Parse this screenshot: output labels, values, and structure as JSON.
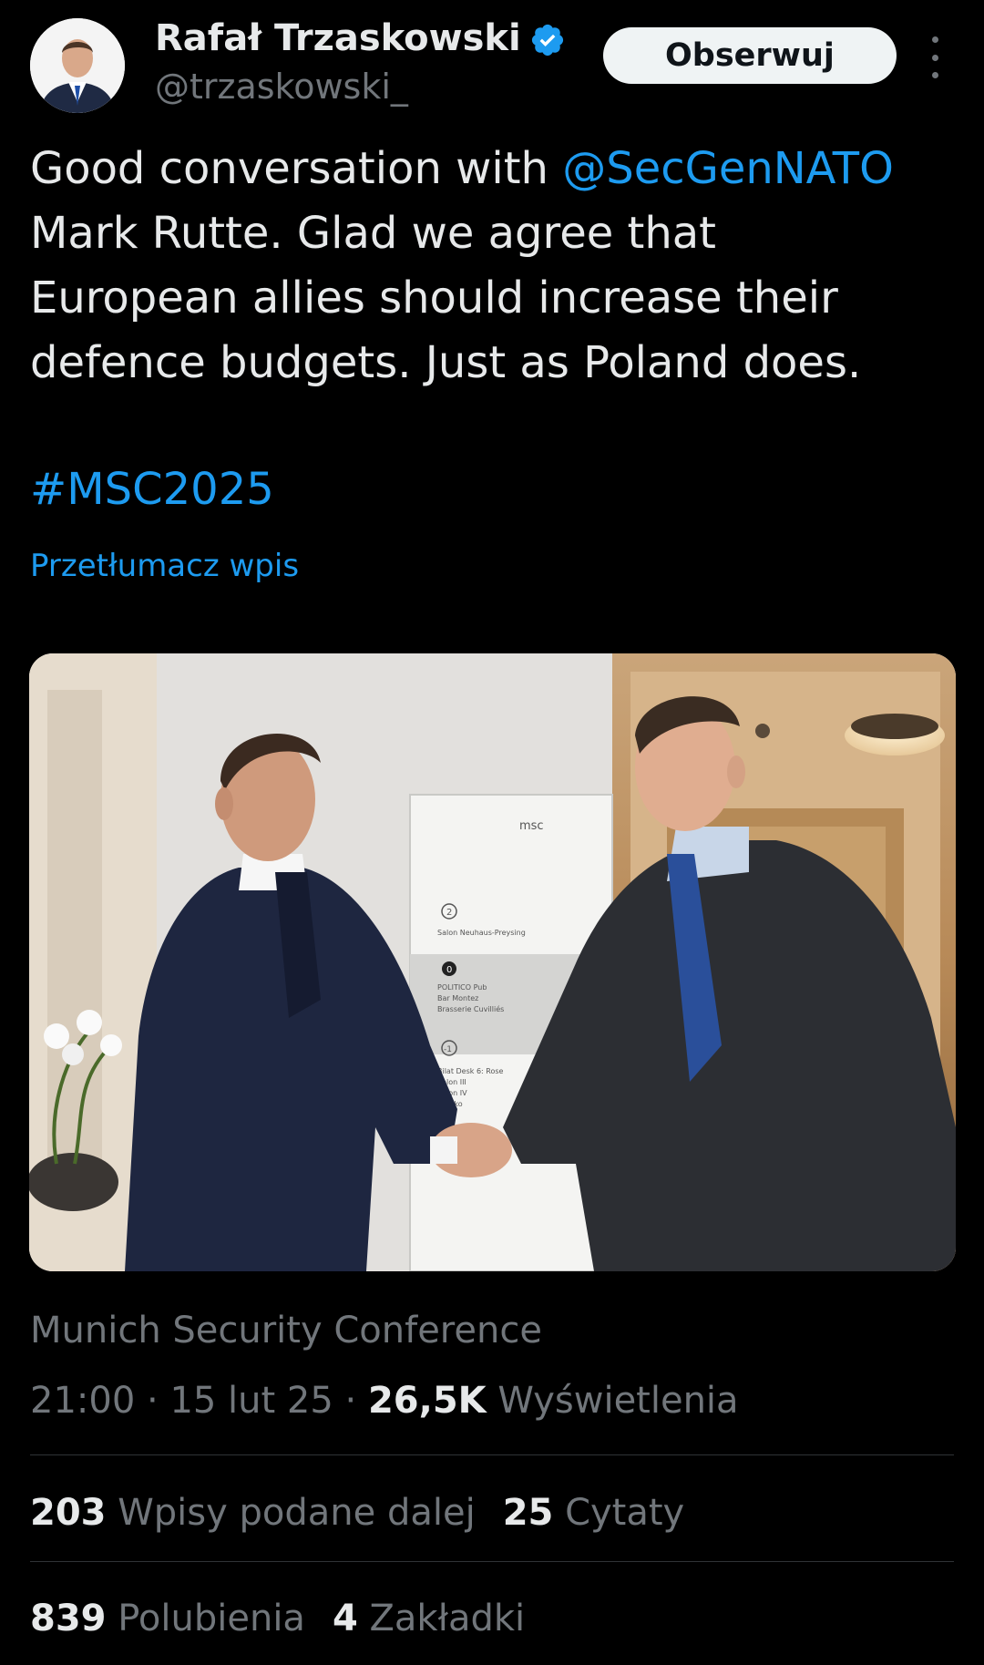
{
  "author": {
    "name": "Rafał Trzaskowski",
    "handle": "@trzaskowski_",
    "verified_icon": "verified-badge-icon"
  },
  "follow_button": "Obserwuj",
  "more_icon": "more-vertical-icon",
  "tweet": {
    "text_part1": "Good conversation with ",
    "mention": "@SecGenNATO",
    "line2": "Mark Rutte. Glad we agree that",
    "line3": "European allies should increase their",
    "line4": "defence budgets. Just as Poland does.",
    "hashtag": "#MSC2025",
    "translate": "Przetłumacz wpis"
  },
  "photo": {
    "sign_logo": "msc",
    "sign_floor_2": "2",
    "sign_floor_2_label": "Salon Neuhaus-Preysing",
    "sign_floor_0": "0",
    "sign_floor_0_lines": [
      "POLITICO Pub",
      "Bar Montez",
      "Brasserie Cuvilliés"
    ],
    "sign_floor_m1": "-1",
    "sign_floor_m1_lines": [
      "Bilat Desk 6: Rose",
      "Salon III",
      "Salon IV",
      "Breako"
    ]
  },
  "location": "Munich Security Conference",
  "meta": {
    "time": "21:00",
    "sep": " · ",
    "date": "15 lut 25",
    "views_count": "26,5K",
    "views_label": "Wyświetlenia"
  },
  "stats": {
    "reposts_count": "203",
    "reposts_label": "Wpisy podane dalej",
    "quotes_count": "25",
    "quotes_label": "Cytaty",
    "likes_count": "839",
    "likes_label": "Polubienia",
    "bookmarks_count": "4",
    "bookmarks_label": "Zakładki"
  },
  "colors": {
    "background": "#000000",
    "text": "#e7e9ea",
    "secondary": "#71767b",
    "accent": "#1d9bf0",
    "divider": "#2f3336"
  }
}
